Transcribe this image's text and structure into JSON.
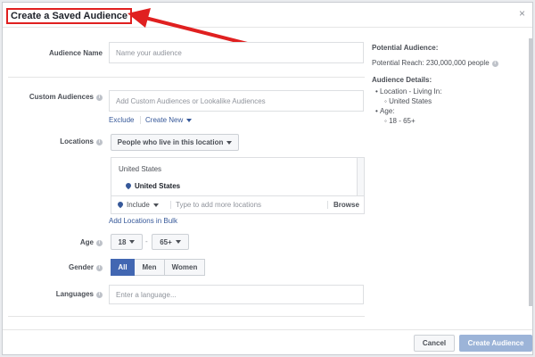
{
  "dialog": {
    "title": "Create a Saved Audience",
    "close": "×"
  },
  "audience_name": {
    "label": "Audience Name",
    "placeholder": "Name your audience"
  },
  "custom_audiences": {
    "label": "Custom Audiences",
    "placeholder": "Add Custom Audiences or Lookalike Audiences",
    "exclude": "Exclude",
    "create_new": "Create New"
  },
  "locations": {
    "label": "Locations",
    "dropdown": "People who live in this location",
    "country_header": "United States",
    "selected": "United States",
    "include": "Include",
    "type_placeholder": "Type to add more locations",
    "browse": "Browse",
    "add_bulk": "Add Locations in Bulk"
  },
  "age": {
    "label": "Age",
    "min": "18",
    "dash": "-",
    "max": "65+"
  },
  "gender": {
    "label": "Gender",
    "options": [
      "All",
      "Men",
      "Women"
    ],
    "selected": "All"
  },
  "languages": {
    "label": "Languages",
    "placeholder": "Enter a language..."
  },
  "summary": {
    "potential_audience_label": "Potential Audience:",
    "potential_reach": "Potential Reach: 230,000,000 people",
    "details_label": "Audience Details:",
    "location_line": "Location - Living In:",
    "location_value": "United States",
    "age_line": "Age:",
    "age_value": "18 - 65+"
  },
  "footer": {
    "cancel": "Cancel",
    "create": "Create Audience"
  },
  "colors": {
    "accent": "#4267b2",
    "link": "#365899",
    "annotation_red": "#e02020",
    "primary_disabled": "#9cb4d8"
  }
}
